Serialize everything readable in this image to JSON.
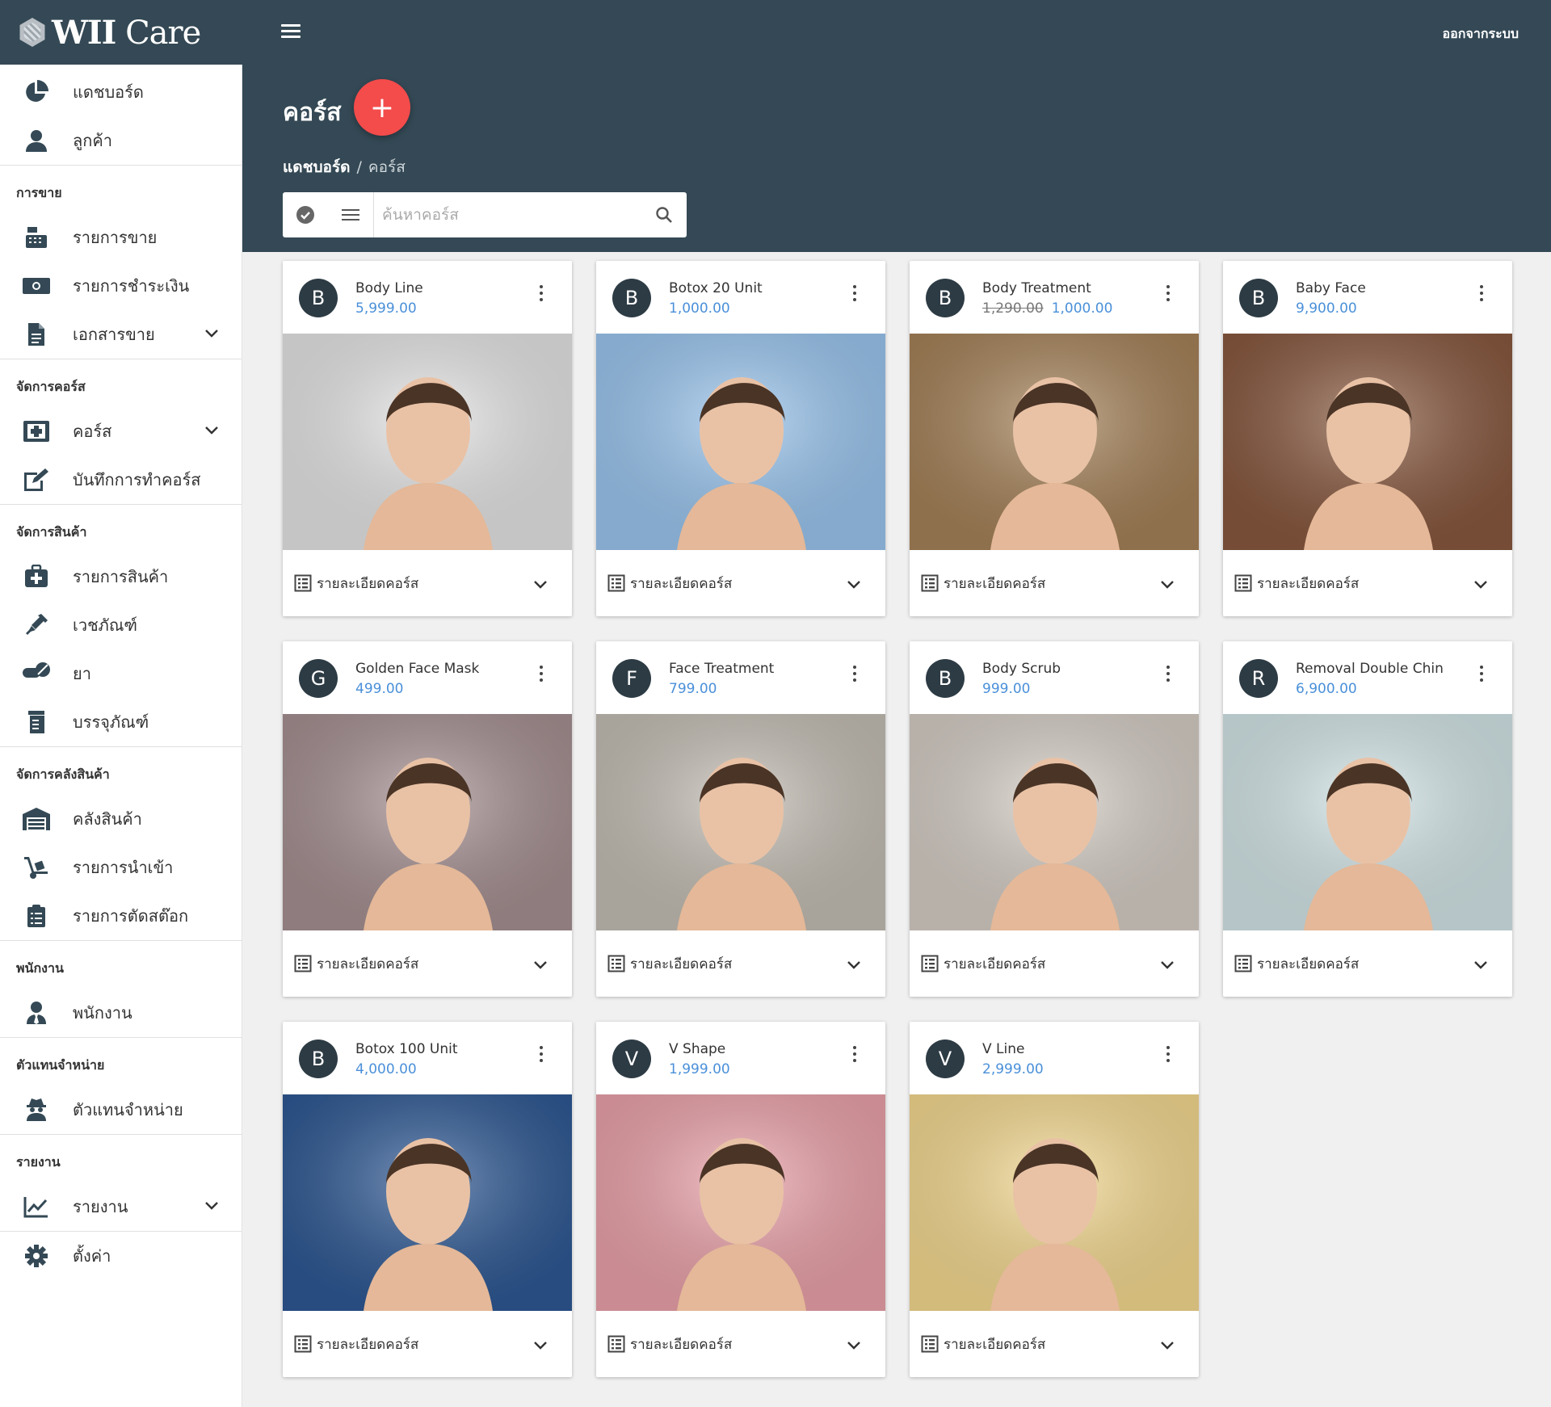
{
  "app": {
    "logo_text_bold": "WII",
    "logo_text": "Care",
    "logout": "ออกจากระบบ"
  },
  "sidebar": {
    "top_items": [
      {
        "label": "แดชบอร์ด",
        "icon": "dashboard-pie-icon"
      },
      {
        "label": "ลูกค้า",
        "icon": "user-icon"
      }
    ],
    "sections": [
      {
        "title": "การขาย",
        "items": [
          {
            "label": "รายการขาย",
            "icon": "cash-register-icon"
          },
          {
            "label": "รายการชำระเงิน",
            "icon": "money-bill-icon"
          },
          {
            "label": "เอกสารขาย",
            "icon": "document-icon",
            "expandable": true
          }
        ]
      },
      {
        "title": "จัดการคอร์ส",
        "items": [
          {
            "label": "คอร์ส",
            "icon": "medical-box-icon",
            "expandable": true
          },
          {
            "label": "บันทึกการทำคอร์ส",
            "icon": "edit-icon"
          }
        ]
      },
      {
        "title": "จัดการสินค้า",
        "items": [
          {
            "label": "รายการสินค้า",
            "icon": "medkit-icon"
          },
          {
            "label": "เวชภัณฑ์",
            "icon": "syringe-icon"
          },
          {
            "label": "ยา",
            "icon": "pills-icon"
          },
          {
            "label": "บรรจุภัณฑ์",
            "icon": "package-icon"
          }
        ]
      },
      {
        "title": "จัดการคลังสินค้า",
        "items": [
          {
            "label": "คลังสินค้า",
            "icon": "warehouse-icon"
          },
          {
            "label": "รายการนำเข้า",
            "icon": "dolly-icon"
          },
          {
            "label": "รายการตัดสต๊อก",
            "icon": "clipboard-list-icon"
          }
        ]
      },
      {
        "title": "พนักงาน",
        "items": [
          {
            "label": "พนักงาน",
            "icon": "user-tie-icon"
          }
        ]
      },
      {
        "title": "ตัวแทนจำหน่าย",
        "items": [
          {
            "label": "ตัวแทนจำหน่าย",
            "icon": "user-secret-icon"
          }
        ]
      },
      {
        "title": "รายงาน",
        "items": [
          {
            "label": "รายงาน",
            "icon": "chart-line-icon",
            "expandable": true
          }
        ]
      }
    ],
    "bottom_items": [
      {
        "label": "ตั้งค่า",
        "icon": "gear-icon"
      }
    ]
  },
  "header": {
    "title": "คอร์ส",
    "add_label": "+",
    "breadcrumb_home": "แดชบอร์ด",
    "breadcrumb_sep": "/",
    "breadcrumb_current": "คอร์ส",
    "search_placeholder": "ค้นหาคอร์ส"
  },
  "cards": [
    {
      "initial": "B",
      "name": "Body Line",
      "price": "5,999.00",
      "old_price": "",
      "detail": "รายละเอียดคอร์ส",
      "bg": "#e8e8e8"
    },
    {
      "initial": "B",
      "name": "Botox 20 Unit",
      "price": "1,000.00",
      "old_price": "",
      "detail": "รายละเอียดคอร์ส",
      "bg": "#9cc8f2"
    },
    {
      "initial": "B",
      "name": "Body Treatment",
      "price": "1,000.00",
      "old_price": "1,290.00",
      "detail": "รายละเอียดคอร์ส",
      "bg": "#a8845a"
    },
    {
      "initial": "B",
      "name": "Baby Face",
      "price": "9,900.00",
      "old_price": "",
      "detail": "รายละเอียดคอร์ส",
      "bg": "#8a5a40"
    },
    {
      "initial": "G",
      "name": "Golden Face Mask",
      "price": "499.00",
      "old_price": "",
      "detail": "รายละเอียดคอร์ส",
      "bg": "#a89294"
    },
    {
      "initial": "F",
      "name": "Face Treatment",
      "price": "799.00",
      "old_price": "",
      "detail": "รายละเอียดคอร์ส",
      "bg": "#c6c0b6"
    },
    {
      "initial": "B",
      "name": "Body Scrub",
      "price": "999.00",
      "old_price": "",
      "detail": "รายละเอียดคอร์ส",
      "bg": "#d8d0c8"
    },
    {
      "initial": "R",
      "name": "Removal Double Chin",
      "price": "6,900.00",
      "old_price": "",
      "detail": "รายละเอียดคอร์ส",
      "bg": "#d6e8ea"
    },
    {
      "initial": "B",
      "name": "Botox 100 Unit",
      "price": "4,000.00",
      "old_price": "",
      "detail": "รายละเอียดคอร์ส",
      "bg": "#2f5a96"
    },
    {
      "initial": "V",
      "name": "V Shape",
      "price": "1,999.00",
      "old_price": "",
      "detail": "รายละเอียดคอร์ส",
      "bg": "#eea4ac"
    },
    {
      "initial": "V",
      "name": "V Line",
      "price": "2,999.00",
      "old_price": "",
      "detail": "รายละเอียดคอร์ส",
      "bg": "#f8dc92"
    }
  ],
  "colors": {
    "topbar": "#344955",
    "accent_add": "#f44b4b",
    "price": "#4a90d9"
  }
}
